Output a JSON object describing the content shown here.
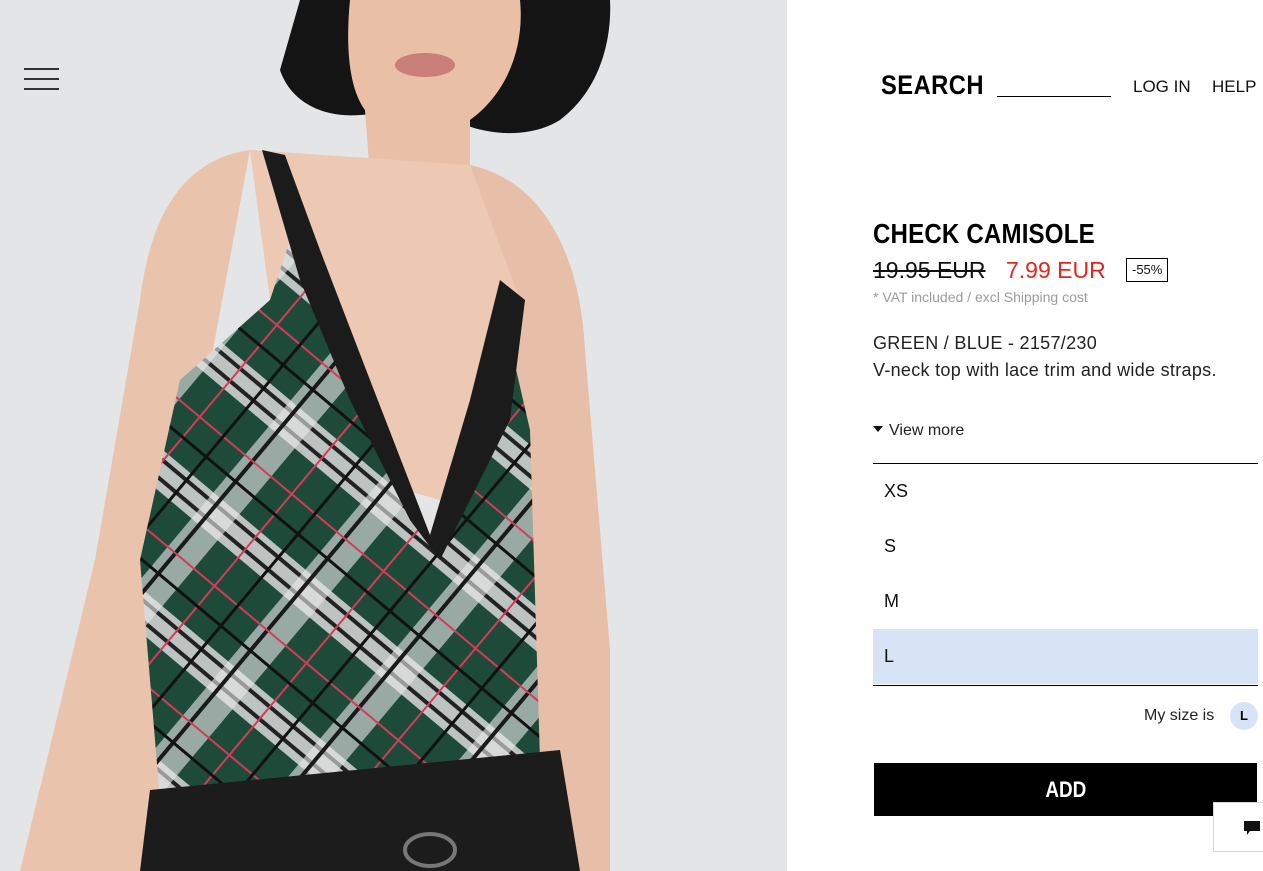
{
  "header": {
    "search_label": "SEARCH",
    "search_value": "",
    "login_label": "LOG IN",
    "help_label": "HELP",
    "menu_icon": "hamburger-menu-icon"
  },
  "product": {
    "title": "CHECK CAMISOLE",
    "old_price": "19.95 EUR",
    "new_price": "7.99 EUR",
    "discount": "-55%",
    "vat_note": "* VAT included / excl Shipping cost",
    "color_ref": "GREEN / BLUE - 2157/230",
    "description": "V-neck top with lace trim and wide straps.",
    "view_more": "View more",
    "image_alt_icon": "product-photo"
  },
  "sizes": {
    "options": [
      "XS",
      "S",
      "M",
      "L"
    ],
    "selected": "L",
    "my_size_label": "My size is",
    "my_size_value": "L"
  },
  "actions": {
    "add_label": "ADD"
  },
  "chat": {
    "icon": "chat-bubble-icon"
  },
  "colors": {
    "sale_red": "#e0271e",
    "selected_blue": "#d6e4f6",
    "button_black": "#000000"
  }
}
